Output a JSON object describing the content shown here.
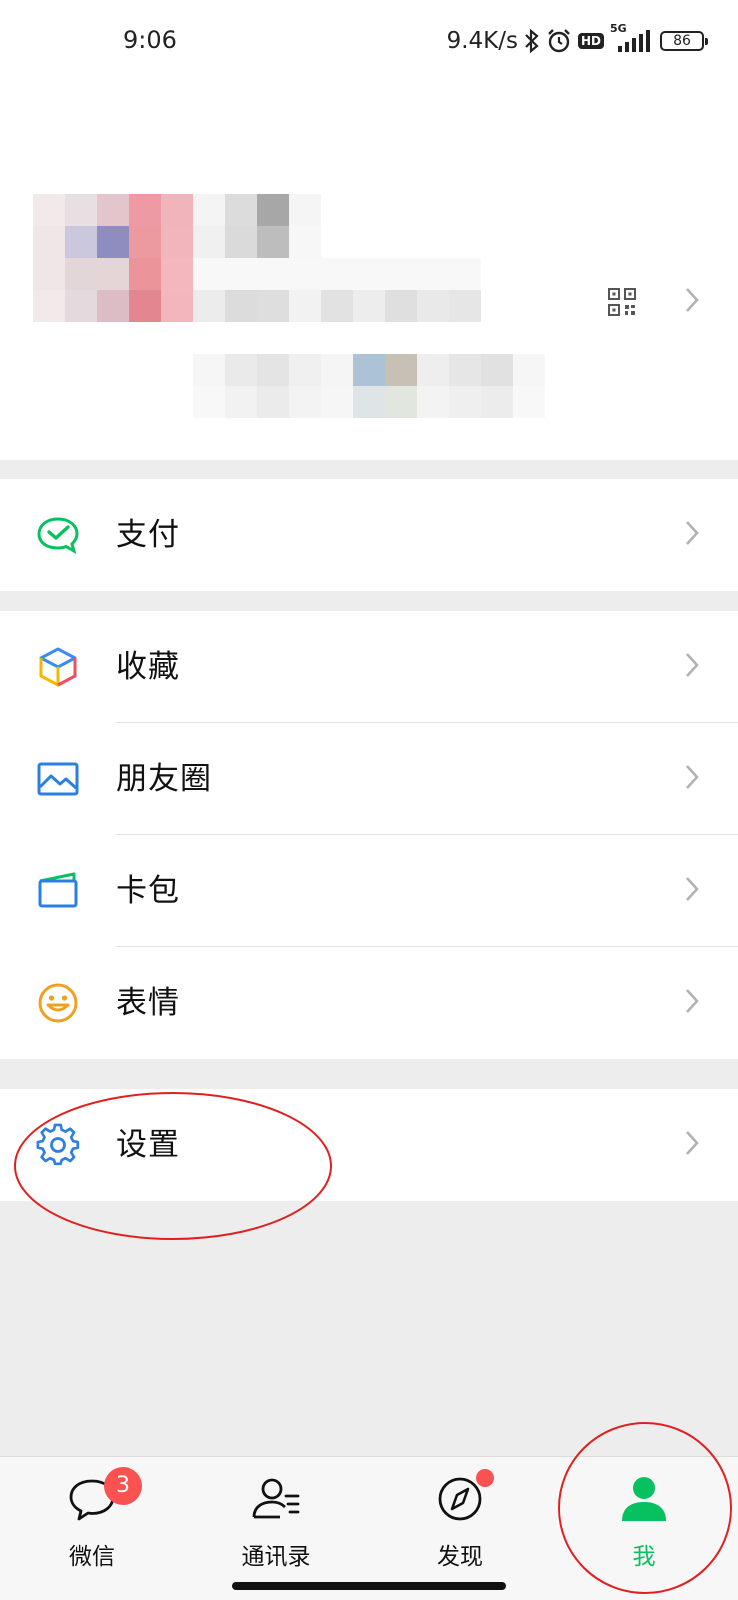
{
  "status_bar": {
    "time": "9:06",
    "speed": "9.4K/s",
    "hd": "HD",
    "network": "5G",
    "battery": "86"
  },
  "profile": {
    "qr_icon": "qr-code-icon",
    "chevron_icon": "chevron-right-icon"
  },
  "menu": {
    "pay": {
      "label": "支付",
      "icon": "wechat-pay-icon"
    },
    "favorites": {
      "label": "收藏",
      "icon": "cube-icon"
    },
    "moments": {
      "label": "朋友圈",
      "icon": "image-icon"
    },
    "cards": {
      "label": "卡包",
      "icon": "card-wallet-icon"
    },
    "stickers": {
      "label": "表情",
      "icon": "smiley-icon"
    },
    "settings": {
      "label": "设置",
      "icon": "gear-icon"
    }
  },
  "tabs": [
    {
      "label": "微信",
      "icon": "chat-bubble-icon",
      "badge": "3",
      "active": false
    },
    {
      "label": "通讯录",
      "icon": "contacts-icon",
      "active": false
    },
    {
      "label": "发现",
      "icon": "compass-icon",
      "dot": true,
      "active": false
    },
    {
      "label": "我",
      "icon": "person-icon",
      "active": true
    }
  ],
  "colors": {
    "accent": "#07c160",
    "badge": "#fa5151",
    "annotation": "#e02020",
    "background": "#ededed"
  }
}
